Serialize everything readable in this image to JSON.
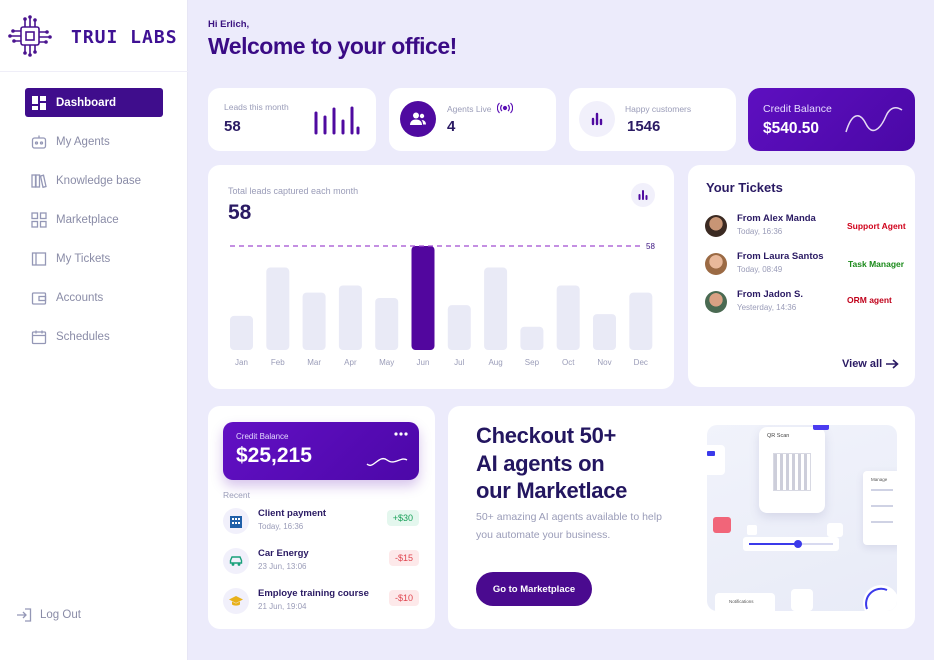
{
  "brand": {
    "name": "TRUI LABS"
  },
  "sidebar": {
    "items": [
      {
        "label": "Dashboard",
        "icon": "dashboard-icon",
        "active": true
      },
      {
        "label": "My Agents",
        "icon": "robot-icon"
      },
      {
        "label": "Knowledge base",
        "icon": "books-icon"
      },
      {
        "label": "Marketplace",
        "icon": "grid-icon"
      },
      {
        "label": "My Tickets",
        "icon": "ticket-icon"
      },
      {
        "label": "Accounts",
        "icon": "wallet-icon"
      },
      {
        "label": "Schedules",
        "icon": "calendar-icon"
      }
    ],
    "logout_label": "Log Out"
  },
  "header": {
    "greeting": "Hi Erlich,",
    "title": "Welcome to your office!"
  },
  "stats": {
    "leads": {
      "label": "Leads this month",
      "value": "58"
    },
    "agents": {
      "label": "Agents Live",
      "value": "4"
    },
    "customers": {
      "label": "Happy customers",
      "value": "1546"
    },
    "credit": {
      "label": "Credit Balance",
      "value": "$540.50"
    }
  },
  "chart_data": {
    "type": "bar",
    "title": "Total leads captured each month",
    "total": "58",
    "categories": [
      "Jan",
      "Feb",
      "Mar",
      "Apr",
      "May",
      "Jun",
      "Jul",
      "Aug",
      "Sep",
      "Oct",
      "Nov",
      "Dec"
    ],
    "values": [
      19,
      46,
      32,
      36,
      29,
      58,
      25,
      46,
      13,
      36,
      20,
      32
    ],
    "highlight": "Jun",
    "reference_line": {
      "value": 58,
      "label": "58"
    },
    "ylim": [
      0,
      58
    ]
  },
  "tickets": {
    "title": "Your Tickets",
    "items": [
      {
        "from": "From Alex Manda",
        "time": "Today, 16:36",
        "tag": "Support Agent",
        "tag_color": "#d0021b"
      },
      {
        "from": "From Laura Santos",
        "time": "Today, 08:49",
        "tag": "Task Manager",
        "tag_color": "#1a8a1a"
      },
      {
        "from": "From Jadon S.",
        "time": "Yesterday, 14:36",
        "tag": "ORM agent",
        "tag_color": "#c0021b"
      }
    ],
    "view_all": "View all"
  },
  "wallet": {
    "label": "Credit Balance",
    "value": "$25,215",
    "recent_label": "Recent",
    "transactions": [
      {
        "name": "Client payment",
        "date": "Today, 16:36",
        "amount": "+$30",
        "type": "credit",
        "icon": "building-icon"
      },
      {
        "name": "Car Energy",
        "date": "23 Jun, 13:06",
        "amount": "-$15",
        "type": "debit",
        "icon": "car-icon"
      },
      {
        "name": "Employe training course",
        "date": "21 Jun, 19:04",
        "amount": "-$10",
        "type": "debit",
        "icon": "graduation-cap-icon"
      }
    ]
  },
  "marketplace": {
    "heading_lines": [
      "Checkout 50+",
      "AI agents on",
      "our Marketlace"
    ],
    "text": "50+ amazing AI agents available to help you automate your business.",
    "button": "Go to Marketplace",
    "illustration": {
      "qr_label": "QR Scan",
      "side_label": "Manage",
      "bottom_label": "Notifications"
    }
  }
}
